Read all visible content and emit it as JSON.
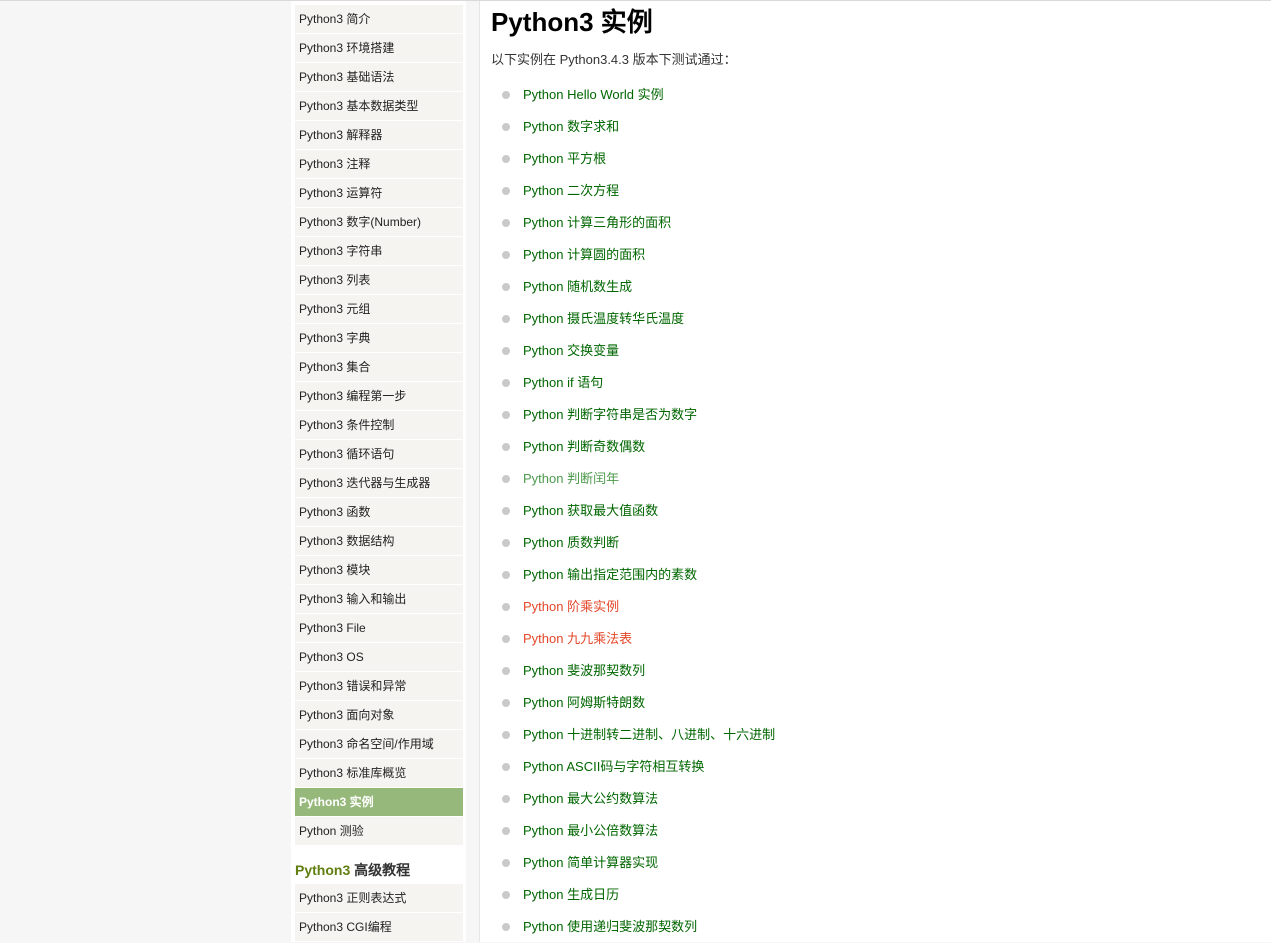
{
  "sidebar": {
    "items": [
      {
        "label": "Python3 简介",
        "active": false
      },
      {
        "label": "Python3 环境搭建",
        "active": false
      },
      {
        "label": "Python3 基础语法",
        "active": false
      },
      {
        "label": "Python3 基本数据类型",
        "active": false
      },
      {
        "label": "Python3 解释器",
        "active": false
      },
      {
        "label": "Python3 注释",
        "active": false
      },
      {
        "label": "Python3 运算符",
        "active": false
      },
      {
        "label": "Python3 数字(Number)",
        "active": false
      },
      {
        "label": "Python3 字符串",
        "active": false
      },
      {
        "label": "Python3 列表",
        "active": false
      },
      {
        "label": "Python3 元组",
        "active": false
      },
      {
        "label": "Python3 字典",
        "active": false
      },
      {
        "label": "Python3 集合",
        "active": false
      },
      {
        "label": "Python3 编程第一步",
        "active": false
      },
      {
        "label": "Python3 条件控制",
        "active": false
      },
      {
        "label": "Python3 循环语句",
        "active": false
      },
      {
        "label": "Python3 迭代器与生成器",
        "active": false
      },
      {
        "label": "Python3 函数",
        "active": false
      },
      {
        "label": "Python3 数据结构",
        "active": false
      },
      {
        "label": "Python3 模块",
        "active": false
      },
      {
        "label": "Python3 输入和输出",
        "active": false
      },
      {
        "label": "Python3 File",
        "active": false
      },
      {
        "label": "Python3 OS",
        "active": false
      },
      {
        "label": "Python3 错误和异常",
        "active": false
      },
      {
        "label": "Python3 面向对象",
        "active": false
      },
      {
        "label": "Python3 命名空间/作用域",
        "active": false
      },
      {
        "label": "Python3 标准库概览",
        "active": false
      },
      {
        "label": "Python3 实例",
        "active": true
      },
      {
        "label": "Python 测验",
        "active": false
      }
    ],
    "section": {
      "accent": "Python3",
      "title": " 高级教程"
    },
    "advanced_items": [
      {
        "label": "Python3 正则表达式"
      },
      {
        "label": "Python3 CGI编程"
      }
    ]
  },
  "main": {
    "title": "Python3 实例",
    "intro": "以下实例在 Python3.4.3 版本下测试通过：",
    "examples": [
      {
        "label": "Python Hello World 实例",
        "state": "normal"
      },
      {
        "label": "Python 数字求和",
        "state": "normal"
      },
      {
        "label": "Python 平方根",
        "state": "normal"
      },
      {
        "label": "Python 二次方程",
        "state": "normal"
      },
      {
        "label": "Python 计算三角形的面积",
        "state": "normal"
      },
      {
        "label": "Python 计算圆的面积",
        "state": "normal"
      },
      {
        "label": "Python 随机数生成",
        "state": "normal"
      },
      {
        "label": "Python 摄氏温度转华氏温度",
        "state": "normal"
      },
      {
        "label": "Python 交换变量",
        "state": "normal"
      },
      {
        "label": "Python if 语句",
        "state": "normal"
      },
      {
        "label": "Python 判断字符串是否为数字",
        "state": "normal"
      },
      {
        "label": "Python 判断奇数偶数",
        "state": "normal"
      },
      {
        "label": "Python 判断闰年",
        "state": "visited"
      },
      {
        "label": "Python 获取最大值函数",
        "state": "normal"
      },
      {
        "label": "Python 质数判断",
        "state": "normal"
      },
      {
        "label": "Python 输出指定范围内的素数",
        "state": "normal"
      },
      {
        "label": "Python 阶乘实例",
        "state": "hot"
      },
      {
        "label": "Python 九九乘法表",
        "state": "hot"
      },
      {
        "label": "Python 斐波那契数列",
        "state": "normal"
      },
      {
        "label": "Python 阿姆斯特朗数",
        "state": "normal"
      },
      {
        "label": "Python 十进制转二进制、八进制、十六进制",
        "state": "normal"
      },
      {
        "label": "Python ASCII码与字符相互转换",
        "state": "normal"
      },
      {
        "label": "Python 最大公约数算法",
        "state": "normal"
      },
      {
        "label": "Python 最小公倍数算法",
        "state": "normal"
      },
      {
        "label": "Python 简单计算器实现",
        "state": "normal"
      },
      {
        "label": "Python 生成日历",
        "state": "normal"
      },
      {
        "label": "Python 使用递归斐波那契数列",
        "state": "normal"
      }
    ]
  },
  "colors": {
    "link": "#006600",
    "visited_link": "#4d9a4d",
    "hot_link": "#e4482a",
    "active_item_bg": "#96b97b",
    "section_accent": "#617f10"
  }
}
